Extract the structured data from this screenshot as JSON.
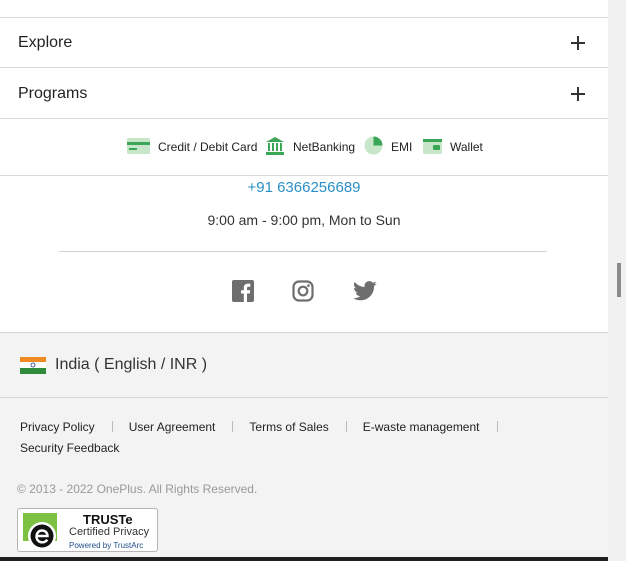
{
  "accordion": {
    "explore_label": "Explore",
    "programs_label": "Programs"
  },
  "payments": {
    "card": "Credit / Debit Card",
    "netbanking": "NetBanking",
    "emi": "EMI",
    "wallet": "Wallet"
  },
  "contact": {
    "phone": "+91 6366256689",
    "hours": "9:00 am - 9:00 pm, Mon to Sun"
  },
  "social": {
    "icons": [
      "facebook-icon",
      "instagram-icon",
      "twitter-icon"
    ]
  },
  "region": {
    "label": "India ( English / INR )"
  },
  "footer_links": {
    "privacy": "Privacy Policy",
    "user_agreement": "User Agreement",
    "terms": "Terms of Sales",
    "ewaste": "E-waste management",
    "security": "Security Feedback"
  },
  "copyright": "© 2013 - 2022 OnePlus. All Rights Reserved.",
  "truste": {
    "title": "TRUSTe",
    "subtitle": "Certified Privacy",
    "powered": "Powered by TrustArc"
  },
  "colors": {
    "link_blue": "#2b8fc7",
    "pay_green": "#3aa757",
    "social_grey": "#6e6e6e"
  }
}
